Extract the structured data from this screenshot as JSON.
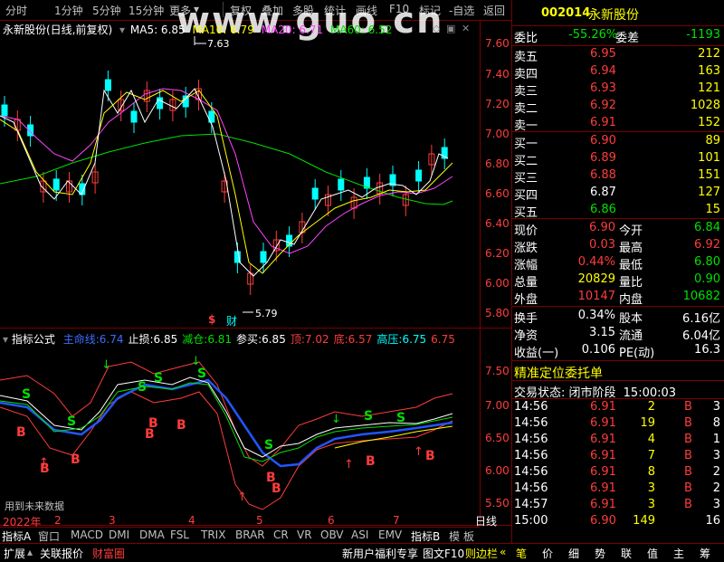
{
  "toolbar": {
    "items": [
      "分时",
      "1分钟",
      "5分钟",
      "15分钟",
      "更多",
      "复权",
      "叠加",
      "多股",
      "统计",
      "画线",
      "F10",
      "标记",
      "-自选",
      "返回"
    ]
  },
  "watermark": "www.guo.cn",
  "chart_title": "永新股份(日线,前复权)",
  "ma_legend": {
    "ma5": "MA5: 6.85",
    "ma10": "MA10: 6.79",
    "ma20": "MA20: 6.71",
    "ma60": "MA60: 6.52",
    "colors": {
      "ma5": "#ffffff",
      "ma10": "#ffff00",
      "ma20": "#ff44ff",
      "ma60": "#00e000"
    }
  },
  "main_chart": {
    "high_label": "7.63",
    "low_label": "5.79",
    "event_label_1": "$",
    "event_label_2": "财",
    "yticks": [
      "7.60",
      "7.40",
      "7.20",
      "7.00",
      "6.80",
      "6.60",
      "6.40",
      "6.20",
      "6.00",
      "5.80"
    ]
  },
  "indicator": {
    "name": "指标公式",
    "items": [
      {
        "label": "主命线",
        "value": "6.74",
        "color": "#3c6cff"
      },
      {
        "label": "止损",
        "value": "6.85",
        "color": "#ffffff"
      },
      {
        "label": "减仓",
        "value": "6.81",
        "color": "#00e000"
      },
      {
        "label": "参买",
        "value": "6.85",
        "color": "#ffffff"
      },
      {
        "label": "顶",
        "value": "7.02",
        "color": "#ff3c3c"
      },
      {
        "label": "底",
        "value": "6.57",
        "color": "#ff3c3c"
      },
      {
        "label": "高压",
        "value": "6.75",
        "color": "#00ffff"
      },
      {
        "label": "",
        "value": "6.75",
        "color": "#ff3c3c"
      }
    ],
    "yticks": [
      "7.50",
      "7.00",
      "6.50",
      "6.00",
      "5.50"
    ],
    "note": "用到未来数据",
    "buy_sign": "B",
    "sell_sign": "S"
  },
  "xaxis": {
    "labels": [
      "2022年",
      "2",
      "3",
      "4",
      "5",
      "6",
      "7"
    ],
    "period": "日线"
  },
  "bottom_tabs": [
    "指标A",
    "窗口",
    "MACD",
    "DMI",
    "DMA",
    "FSL",
    "TRIX",
    "BRAR",
    "CR",
    "VR",
    "OBV",
    "ASI",
    "EMV",
    "指标B",
    "模",
    "板"
  ],
  "bottom_bar": {
    "left": [
      "扩展",
      "关联报价",
      "财富圈"
    ],
    "center": [
      "新用户福利专享",
      "图文F10",
      "则边栏"
    ],
    "right": [
      "笔",
      "价",
      "细",
      "势",
      "联",
      "值",
      "主",
      "筹"
    ]
  },
  "quote": {
    "code": "002014",
    "name": "永新股份",
    "weibi_label": "委比",
    "weibi": "-55.26%",
    "weicha_label": "委差",
    "weicha": "-1193",
    "asks": [
      {
        "label": "卖五",
        "price": "6.95",
        "vol": "212"
      },
      {
        "label": "卖四",
        "price": "6.94",
        "vol": "163"
      },
      {
        "label": "卖三",
        "price": "6.93",
        "vol": "121"
      },
      {
        "label": "卖二",
        "price": "6.92",
        "vol": "1028"
      },
      {
        "label": "卖一",
        "price": "6.91",
        "vol": "152"
      }
    ],
    "bids": [
      {
        "label": "买一",
        "price": "6.90",
        "vol": "89",
        "pcolor": "#ff3c3c"
      },
      {
        "label": "买二",
        "price": "6.89",
        "vol": "101",
        "pcolor": "#ff3c3c"
      },
      {
        "label": "买三",
        "price": "6.88",
        "vol": "151",
        "pcolor": "#ff3c3c"
      },
      {
        "label": "买四",
        "price": "6.87",
        "vol": "127",
        "pcolor": "#ffffff"
      },
      {
        "label": "买五",
        "price": "6.86",
        "vol": "15",
        "pcolor": "#00e000"
      }
    ],
    "stats": [
      {
        "l1": "现价",
        "v1": "6.90",
        "c1": "#ff3c3c",
        "l2": "今开",
        "v2": "6.84",
        "c2": "#00e000"
      },
      {
        "l1": "涨跌",
        "v1": "0.03",
        "c1": "#ff3c3c",
        "l2": "最高",
        "v2": "6.92",
        "c2": "#ff3c3c"
      },
      {
        "l1": "涨幅",
        "v1": "0.44%",
        "c1": "#ff3c3c",
        "l2": "最低",
        "v2": "6.80",
        "c2": "#00e000"
      },
      {
        "l1": "总量",
        "v1": "20829",
        "c1": "#ffff00",
        "l2": "量比",
        "v2": "0.90",
        "c2": "#00e000"
      },
      {
        "l1": "外盘",
        "v1": "10147",
        "c1": "#ff3c3c",
        "l2": "内盘",
        "v2": "10682",
        "c2": "#00e000"
      }
    ],
    "stats2": [
      {
        "l1": "换手",
        "v1": "0.34%",
        "l2": "股本",
        "v2": "6.16亿"
      },
      {
        "l1": "净资",
        "v1": "3.15",
        "l2": "流通",
        "v2": "6.04亿"
      },
      {
        "l1": "收益(一)",
        "v1": "0.106",
        "l2": "PE(动)",
        "v2": "16.3"
      }
    ],
    "entrust_title": "精准定位委托单",
    "trade_status_label": "交易状态: 闭市阶段",
    "trade_status_time": "15:00:03",
    "ticks": [
      {
        "time": "14:56",
        "price": "6.91",
        "vol": "2",
        "bs": "B",
        "n": "3"
      },
      {
        "time": "14:56",
        "price": "6.91",
        "vol": "19",
        "bs": "B",
        "n": "8"
      },
      {
        "time": "14:56",
        "price": "6.91",
        "vol": "4",
        "bs": "B",
        "n": "1"
      },
      {
        "time": "14:56",
        "price": "6.91",
        "vol": "7",
        "bs": "B",
        "n": "3"
      },
      {
        "time": "14:56",
        "price": "6.91",
        "vol": "8",
        "bs": "B",
        "n": "2"
      },
      {
        "time": "14:56",
        "price": "6.91",
        "vol": "3",
        "bs": "B",
        "n": "2"
      },
      {
        "time": "14:57",
        "price": "6.91",
        "vol": "3",
        "bs": "B",
        "n": "3"
      },
      {
        "time": "15:00",
        "price": "6.90",
        "vol": "149",
        "bs": "",
        "n": "16"
      }
    ]
  }
}
